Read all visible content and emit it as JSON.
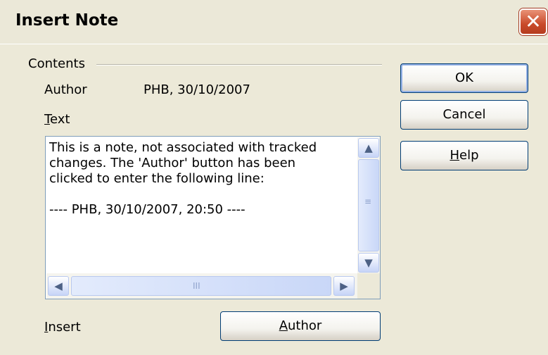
{
  "dialog": {
    "title": "Insert Note",
    "close_glyph": "✕"
  },
  "contents": {
    "group_label": "Contents",
    "author_label": "Author",
    "author_value": "PHB, 30/10/2007",
    "text_label_underlined": "T",
    "text_label_rest": "ext",
    "text_lines": [
      "This is a note, not associated with tracked",
      "changes. The 'Author' button has been",
      "clicked to enter the following line:",
      "",
      "---- PHB, 30/10/2007, 20:50 ----"
    ],
    "insert_label_underlined": "I",
    "insert_label_rest": "nsert",
    "author_button_underlined": "A",
    "author_button_rest": "uthor"
  },
  "buttons": {
    "ok": "OK",
    "cancel": "Cancel",
    "help_underlined": "H",
    "help_rest": "elp"
  },
  "scrollbar": {
    "up_glyph": "▲",
    "down_glyph": "▼",
    "left_glyph": "◀",
    "right_glyph": "▶",
    "v_grip": "≡",
    "h_grip": "III"
  }
}
